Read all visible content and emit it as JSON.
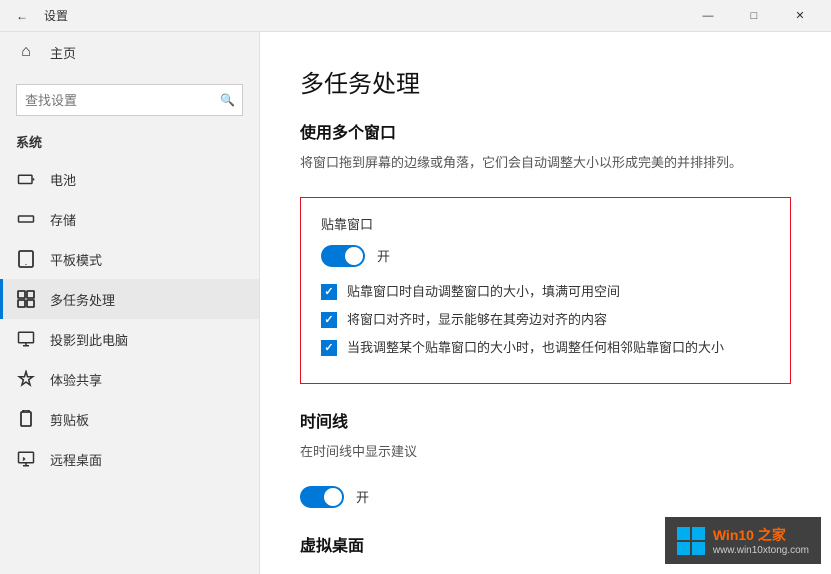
{
  "titlebar": {
    "title": "设置",
    "back_label": "←",
    "minimize": "—",
    "restore": "□",
    "close": "✕"
  },
  "sidebar": {
    "home_label": "主页",
    "search_placeholder": "查找设置",
    "section_title": "系统",
    "items": [
      {
        "id": "battery",
        "icon": "🔋",
        "label": "电池"
      },
      {
        "id": "storage",
        "icon": "💾",
        "label": "存储"
      },
      {
        "id": "tablet",
        "icon": "📱",
        "label": "平板模式"
      },
      {
        "id": "multitask",
        "icon": "⊞",
        "label": "多任务处理",
        "active": true
      },
      {
        "id": "project",
        "icon": "🖥",
        "label": "投影到此电脑"
      },
      {
        "id": "experience",
        "icon": "✦",
        "label": "体验共享"
      },
      {
        "id": "clipboard",
        "icon": "📋",
        "label": "剪贴板"
      },
      {
        "id": "remote",
        "icon": "🖥",
        "label": "远程桌面"
      }
    ]
  },
  "content": {
    "title": "多任务处理",
    "subtitle": "使用多个窗口",
    "desc": "将窗口拖到屏幕的边缘或角落，它们会自动调整大小以形成完美的并排排列。",
    "snap_section": {
      "label": "贴靠窗口",
      "toggle_state": "开",
      "checkboxes": [
        {
          "label": "贴靠窗口时自动调整窗口的大小，填满可用空间"
        },
        {
          "label": "将窗口对齐时，显示能够在其旁边对齐的内容"
        },
        {
          "label": "当我调整某个贴靠窗口的大小时，也调整任何相邻贴靠窗口的大小"
        }
      ]
    },
    "timeline_section": {
      "subtitle": "时间线",
      "desc": "在时间线中显示建议",
      "toggle_state": "开"
    },
    "virtual_section": {
      "subtitle": "虚拟桌面"
    }
  },
  "watermark": {
    "brand": "Win10",
    "brand_suffix": " 之家",
    "url": "www.win10xtong.com"
  }
}
